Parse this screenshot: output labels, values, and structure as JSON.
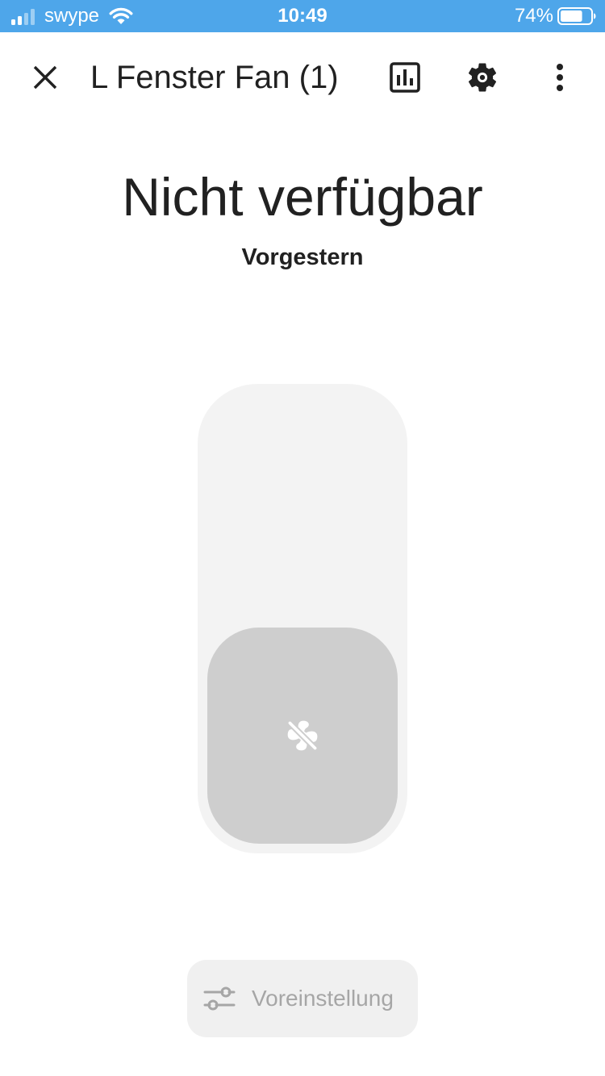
{
  "status_bar": {
    "carrier": "swype",
    "time": "10:49",
    "battery_percent": "74%",
    "battery_level": 0.74
  },
  "header": {
    "title": "L Fenster Fan (1)",
    "icons": [
      "close-icon",
      "history-chart-icon",
      "settings-gear-icon",
      "more-vertical-icon"
    ]
  },
  "entity": {
    "state": "Nicht verfügbar",
    "last_changed": "Vorgestern"
  },
  "fan_control": {
    "level": 0.48,
    "icon": "fan-off-icon",
    "slider_color": "#f3f3f3",
    "knob_color": "#cecece"
  },
  "preset": {
    "label": "Voreinstellung",
    "icon": "tune-sliders-icon",
    "disabled": true
  },
  "colors": {
    "status_bar": "#4ea6ea",
    "text": "#212121",
    "muted": "#a6a6a6"
  }
}
